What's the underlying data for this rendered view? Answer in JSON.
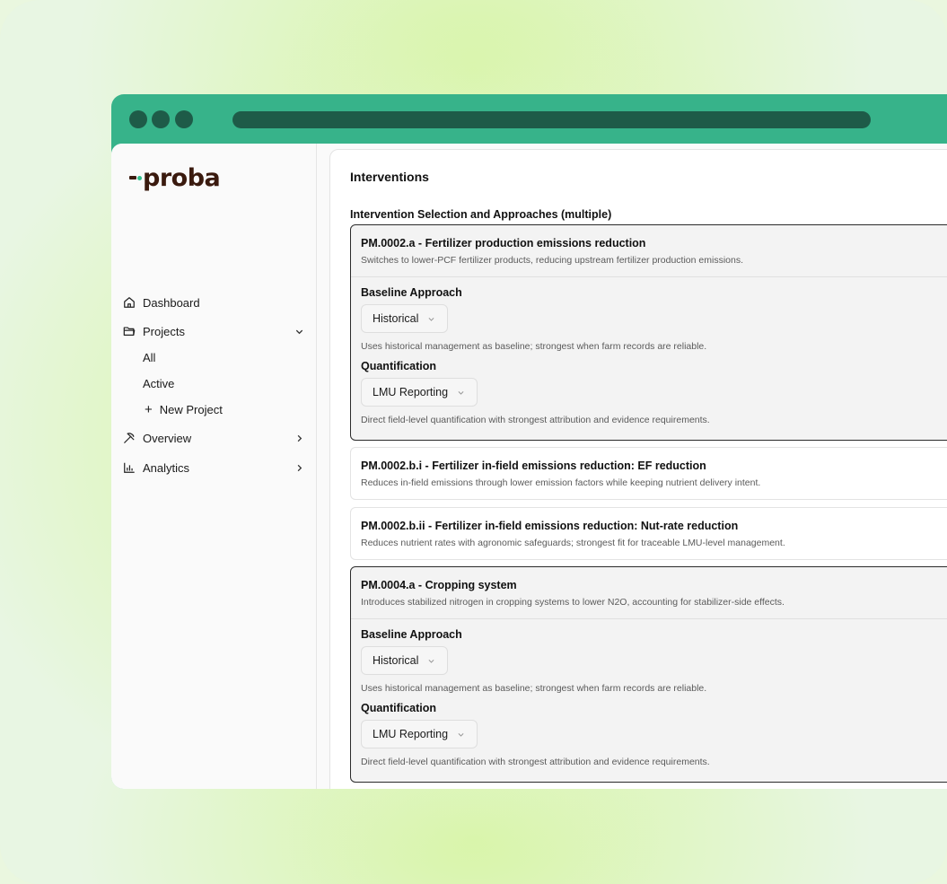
{
  "app": {
    "logo_text": "proba"
  },
  "sidebar": {
    "items": [
      {
        "label": "Dashboard",
        "icon": "home-icon"
      },
      {
        "label": "Projects",
        "icon": "folder-icon",
        "expanded": true
      },
      {
        "label": "Overview",
        "icon": "pickaxe-icon"
      },
      {
        "label": "Analytics",
        "icon": "bar-chart-icon"
      }
    ],
    "project_sub": [
      {
        "label": "All"
      },
      {
        "label": "Active"
      },
      {
        "label": "New Project",
        "prefix": "+"
      }
    ]
  },
  "main": {
    "title": "Interventions",
    "section_label": "Intervention Selection and Approaches (multiple)",
    "cards": [
      {
        "title": "PM.0002.a - Fertilizer production emissions reduction",
        "desc": "Switches to lower-PCF fertilizer products, reducing upstream fertilizer production emissions.",
        "selected": true,
        "baseline_label": "Baseline Approach",
        "baseline_value": "Historical",
        "baseline_help": "Uses historical management as baseline; strongest when farm records are reliable.",
        "quant_label": "Quantification",
        "quant_value": "LMU Reporting",
        "quant_help": "Direct field-level quantification with strongest attribution and evidence requirements."
      },
      {
        "title": "PM.0002.b.i - Fertilizer in-field emissions reduction: EF reduction",
        "desc": "Reduces in-field emissions through lower emission factors while keeping nutrient delivery intent.",
        "selected": false
      },
      {
        "title": "PM.0002.b.ii - Fertilizer in-field emissions reduction: Nut-rate reduction",
        "desc": "Reduces nutrient rates with agronomic safeguards; strongest fit for traceable LMU-level management.",
        "selected": false
      },
      {
        "title": "PM.0004.a - Cropping system",
        "desc": "Introduces stabilized nitrogen in cropping systems to lower N2O, accounting for stabilizer-side effects.",
        "selected": true,
        "baseline_label": "Baseline Approach",
        "baseline_value": "Historical",
        "baseline_help": "Uses historical management as baseline; strongest when farm records are reliable.",
        "quant_label": "Quantification",
        "quant_value": "LMU Reporting",
        "quant_help": "Direct field-level quantification with strongest attribution and evidence requirements."
      }
    ]
  },
  "colors": {
    "window_chrome": "#37b38a",
    "chrome_dark": "#1e5b48",
    "logo_brown": "#3a1a0e",
    "logo_accent": "#2fbf8b"
  }
}
